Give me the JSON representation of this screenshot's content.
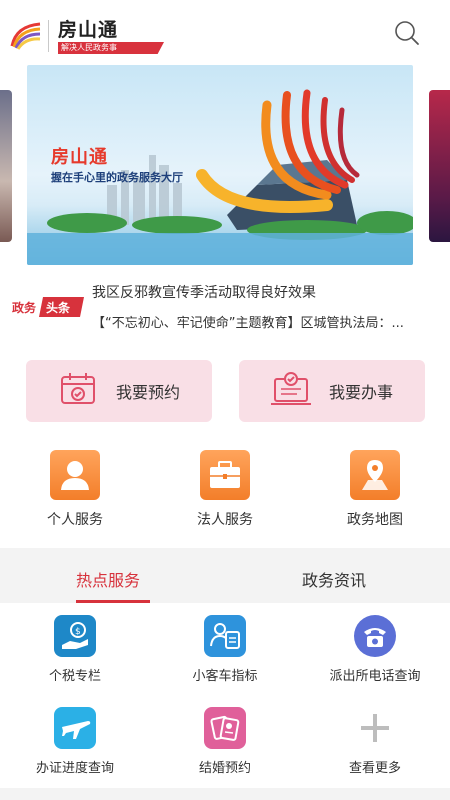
{
  "header": {
    "title": "房山通",
    "subtitle": "解决人民政务事",
    "search_icon": "search-icon"
  },
  "banner": {
    "title": "房山通",
    "subtitle": "握在手心里的政务服务大厅"
  },
  "news": {
    "badge_left": "政务",
    "badge_right": "头条",
    "items": [
      "我区反邪教宣传季活动取得良好效果",
      "【“不忘初心、牢记使命”主题教育】区城管执法局：..."
    ]
  },
  "actions": [
    {
      "label": "我要预约",
      "icon": "calendar-check-icon"
    },
    {
      "label": "我要办事",
      "icon": "laptop-check-icon"
    }
  ],
  "services": [
    {
      "label": "个人服务",
      "icon": "person-icon"
    },
    {
      "label": "法人服务",
      "icon": "briefcase-icon"
    },
    {
      "label": "政务地图",
      "icon": "map-pin-icon"
    }
  ],
  "tabs": [
    {
      "label": "热点服务",
      "active": true
    },
    {
      "label": "政务资讯",
      "active": false
    }
  ],
  "grid": [
    {
      "label": "个税专栏",
      "icon": "hand-money-icon",
      "color": "#1e88c8"
    },
    {
      "label": "小客车指标",
      "icon": "person-document-icon",
      "color": "#2e93dc"
    },
    {
      "label": "派出所电话查询",
      "icon": "telephone-icon",
      "color": "#5b6fd6"
    },
    {
      "label": "办证进度查询",
      "icon": "airplane-icon",
      "color": "#2bb0e6"
    },
    {
      "label": "结婚预约",
      "icon": "marriage-certificate-icon",
      "color": "#e0609a"
    },
    {
      "label": "查看更多",
      "icon": "plus-icon",
      "color": "#bdbdbd"
    }
  ],
  "colors": {
    "accent": "#d7323c",
    "action_bg": "#f9dfe6",
    "service_orange": "#f58a36"
  }
}
